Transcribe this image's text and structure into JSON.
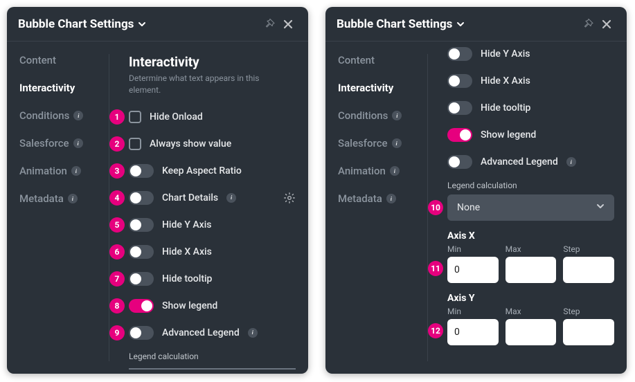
{
  "header": {
    "title": "Bubble Chart Settings"
  },
  "sidebar": {
    "items": [
      {
        "label": "Content",
        "info": false
      },
      {
        "label": "Interactivity",
        "info": false
      },
      {
        "label": "Conditions",
        "info": true
      },
      {
        "label": "Salesforce",
        "info": true
      },
      {
        "label": "Animation",
        "info": true
      },
      {
        "label": "Metadata",
        "info": true
      }
    ]
  },
  "section": {
    "title": "Interactivity",
    "subtitle": "Determine what text appears in this element."
  },
  "rows_left": [
    {
      "n": "1",
      "type": "checkbox",
      "label": "Hide Onload"
    },
    {
      "n": "2",
      "type": "checkbox",
      "label": "Always show value"
    },
    {
      "n": "3",
      "type": "toggle",
      "label": "Keep Aspect Ratio",
      "on": false
    },
    {
      "n": "4",
      "type": "toggle",
      "label": "Chart Details",
      "on": false,
      "info": true,
      "gear": true
    },
    {
      "n": "5",
      "type": "toggle",
      "label": "Hide Y Axis",
      "on": false
    },
    {
      "n": "6",
      "type": "toggle",
      "label": "Hide X Axis",
      "on": false
    },
    {
      "n": "7",
      "type": "toggle",
      "label": "Hide tooltip",
      "on": false
    },
    {
      "n": "8",
      "type": "toggle",
      "label": "Show legend",
      "on": true
    },
    {
      "n": "9",
      "type": "toggle",
      "label": "Advanced Legend",
      "on": false,
      "info": true
    }
  ],
  "legend_calc_label": "Legend calculation",
  "rows_right_top": [
    {
      "label": "Hide Y Axis",
      "on": false
    },
    {
      "label": "Hide X Axis",
      "on": false
    },
    {
      "label": "Hide tooltip",
      "on": false
    },
    {
      "label": "Show legend",
      "on": true
    },
    {
      "label": "Advanced Legend",
      "on": false,
      "info": true
    }
  ],
  "legend_select": {
    "marker": "10",
    "label": "Legend calculation",
    "value": "None"
  },
  "axis_x": {
    "title": "Axis X",
    "marker": "11",
    "min_label": "Min",
    "max_label": "Max",
    "step_label": "Step",
    "min": "0",
    "max": "",
    "step": ""
  },
  "axis_y": {
    "title": "Axis Y",
    "marker": "12",
    "min_label": "Min",
    "max_label": "Max",
    "step_label": "Step",
    "min": "0",
    "max": "",
    "step": ""
  }
}
